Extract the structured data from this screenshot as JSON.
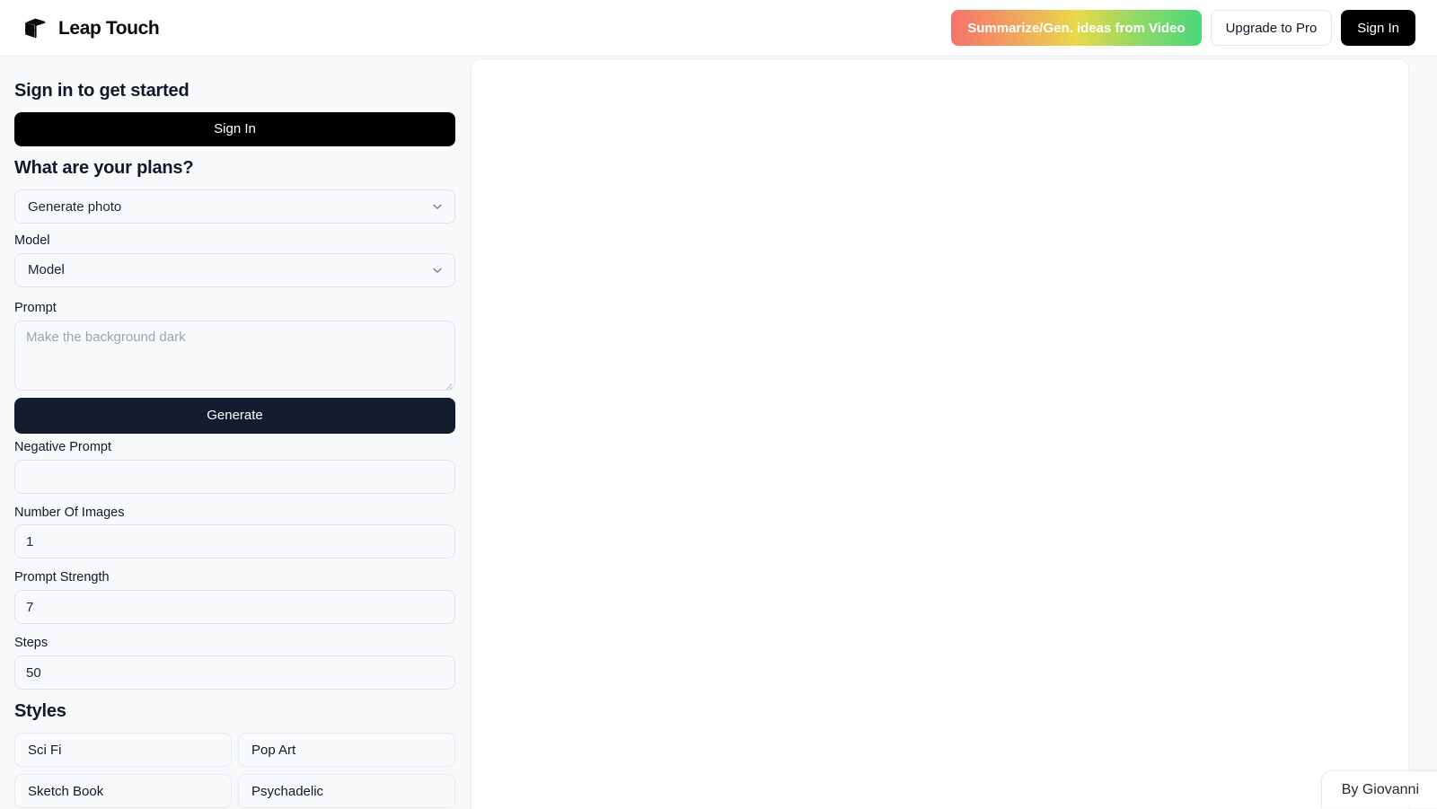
{
  "header": {
    "brand_name": "Leap Touch",
    "logo_icon": "cube-logo-icon",
    "promo_button_label": "Summarize/Gen. ideas from Video",
    "upgrade_button_label": "Upgrade to Pro",
    "signin_button_label": "Sign In",
    "promo_gradient_from": "#f4726b",
    "promo_gradient_mid": "#e8d94a",
    "promo_gradient_to": "#4ad87c",
    "signin_bg": "#000000"
  },
  "sidebar": {
    "signin_heading": "Sign in to get started",
    "signin_button_label": "Sign In",
    "plans_heading": "What are your plans?",
    "plan_select": {
      "value": "Generate photo",
      "caret_icon": "chevron-down-icon"
    },
    "model": {
      "label": "Model",
      "value": "Model",
      "caret_icon": "chevron-down-icon"
    },
    "prompt": {
      "label": "Prompt",
      "value": "",
      "placeholder": "Make the background dark"
    },
    "generate_button_label": "Generate",
    "generate_button_bg": "#141c30",
    "negative_prompt": {
      "label": "Negative Prompt",
      "value": "",
      "placeholder": ""
    },
    "number_of_images": {
      "label": "Number Of Images",
      "value": "1"
    },
    "prompt_strength": {
      "label": "Prompt Strength",
      "value": "7"
    },
    "steps": {
      "label": "Steps",
      "value": "50"
    },
    "styles_heading": "Styles",
    "styles": [
      {
        "label": "Sci Fi"
      },
      {
        "label": "Pop Art"
      },
      {
        "label": "Sketch Book"
      },
      {
        "label": "Psychadelic"
      }
    ]
  },
  "main": {
    "content": ""
  },
  "credit": {
    "label": "By Giovanni"
  }
}
